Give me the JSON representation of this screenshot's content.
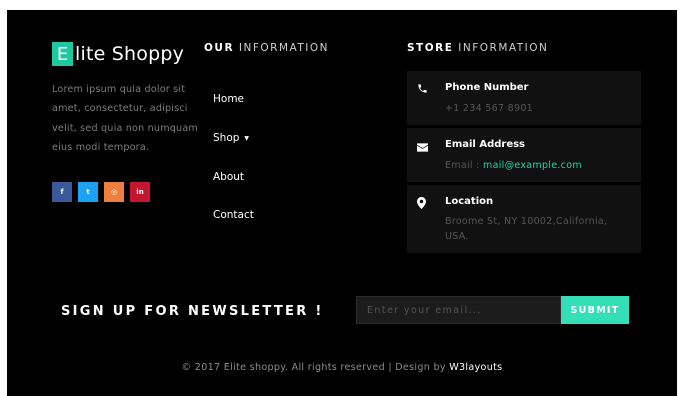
{
  "brand": {
    "letter": "E",
    "rest": "lite Shoppy"
  },
  "about": {
    "text": "Lorem ipsum quia dolor sit amet, consectetur, adipisci velit, sed quia non numquam eius modi tempora."
  },
  "social": [
    {
      "label": "f",
      "icon": "facebook-icon",
      "color": "#3b5998"
    },
    {
      "label": "t",
      "icon": "twitter-icon",
      "color": "#1da1f2"
    },
    {
      "label": "◎",
      "icon": "instagram-icon",
      "color": "#ef7f3f"
    },
    {
      "label": "in",
      "icon": "linkedin-icon",
      "color": "#c4172f"
    }
  ],
  "our_info": {
    "heading_bold": "OUR",
    "heading_light": "INFORMATION",
    "links": [
      "Home",
      "Shop",
      "About",
      "Contact"
    ]
  },
  "store": {
    "heading_bold": "STORE",
    "heading_light": "INFORMATION",
    "phone": {
      "title": "Phone Number",
      "value": "+1 234 567 8901",
      "icon": "phone-icon"
    },
    "email": {
      "title": "Email Address",
      "prefix": "Email :",
      "value": "mail@example.com",
      "icon": "envelope-icon"
    },
    "location": {
      "title": "Location",
      "value": "Broome St, NY 10002,California, USA.",
      "icon": "map-marker-icon"
    }
  },
  "newsletter": {
    "title": "SIGN UP FOR NEWSLETTER !",
    "placeholder": "Enter your email...",
    "button": "SUBMIT"
  },
  "footer": {
    "copyright": "© 2017 Elite shoppy. All rights reserved | Design by",
    "designer": "W3layouts"
  },
  "colors": {
    "accent": "#1fc8a0",
    "button": "#34dfb8",
    "link": "#21d4a4",
    "background": "#000000"
  }
}
